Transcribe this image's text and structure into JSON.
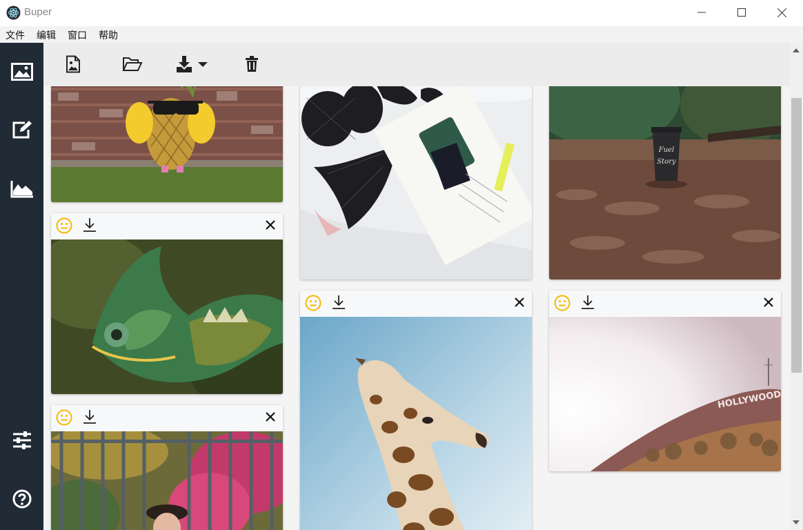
{
  "app": {
    "title": "Buper",
    "accent": "#f5b800",
    "sidebar_color": "#202b36"
  },
  "menu": {
    "items": [
      "文件",
      "编辑",
      "窗口",
      "帮助"
    ]
  },
  "sidebar": {
    "items": [
      {
        "icon": "image-gallery-icon"
      },
      {
        "icon": "edit-icon"
      },
      {
        "icon": "area-chart-icon"
      },
      {
        "icon": "sliders-icon"
      },
      {
        "icon": "help-icon"
      }
    ]
  },
  "toolbar": {
    "items": [
      {
        "icon": "add-image-icon"
      },
      {
        "icon": "open-folder-icon"
      },
      {
        "icon": "download-dropdown-icon"
      },
      {
        "icon": "trash-icon"
      }
    ]
  },
  "gallery": {
    "cards": [
      {
        "subject": "pineapple",
        "has_bar": false
      },
      {
        "subject": "bikini-flatlay",
        "has_bar": false
      },
      {
        "subject": "coffee-cup",
        "has_bar": false
      },
      {
        "subject": "chameleon",
        "has_bar": true
      },
      {
        "subject": "giraffe",
        "has_bar": true
      },
      {
        "subject": "hollywood-sign",
        "has_bar": true,
        "sign_text": "HOLLYWOOD"
      },
      {
        "subject": "girl-flowers",
        "has_bar": true
      }
    ],
    "cup_text": "Fuel Your Story"
  }
}
